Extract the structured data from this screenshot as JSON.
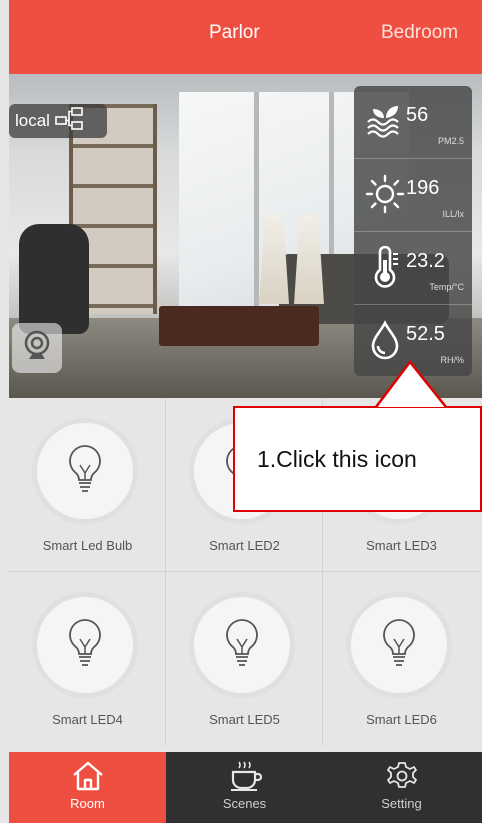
{
  "tabs": [
    {
      "label": "Parlor"
    },
    {
      "label": "Bedroom"
    }
  ],
  "scene": {
    "connection_label": "local"
  },
  "sensors": [
    {
      "value": "56",
      "unit": "PM2.5",
      "icon": "pm25-icon"
    },
    {
      "value": "196",
      "unit": "ILL/lx",
      "icon": "sun-icon"
    },
    {
      "value": "23.2",
      "unit": "Temp/°C",
      "icon": "thermometer-icon"
    },
    {
      "value": "52.5",
      "unit": "RH/%",
      "icon": "humidity-icon"
    }
  ],
  "devices": [
    {
      "label": "Smart Led Bulb"
    },
    {
      "label": "Smart LED2"
    },
    {
      "label": "Smart LED3"
    },
    {
      "label": "Smart LED4"
    },
    {
      "label": "Smart LED5"
    },
    {
      "label": "Smart LED6"
    }
  ],
  "callout": {
    "text": "1.Click this icon"
  },
  "bottom_nav": [
    {
      "label": "Room",
      "icon": "home-icon"
    },
    {
      "label": "Scenes",
      "icon": "coffee-icon"
    },
    {
      "label": "Setting",
      "icon": "gear-icon"
    }
  ],
  "colors": {
    "accent": "#ef4f40",
    "nav_dark": "#303030",
    "callout_border": "#e00000"
  }
}
